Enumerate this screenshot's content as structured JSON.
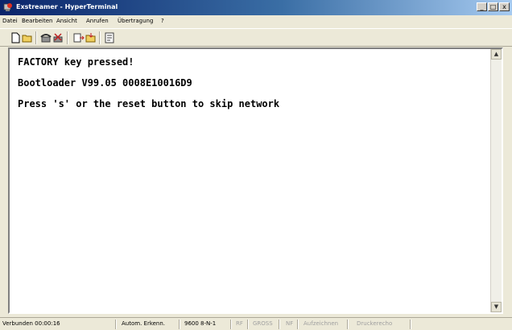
{
  "window": {
    "title": "Exstreamer - HyperTerminal",
    "controls": {
      "minimize": "_",
      "maximize": "□",
      "close": "x"
    }
  },
  "menu": [
    "Datei",
    "Bearbeiten",
    "Ansicht",
    "Anrufen",
    "Übertragung",
    "?"
  ],
  "toolbar": {
    "buttons": [
      "new-document-icon",
      "open-folder-icon",
      "phone-call-icon",
      "disconnect-icon",
      "send-icon",
      "receive-icon",
      "properties-icon"
    ]
  },
  "terminal": {
    "lines": [
      "FACTORY key pressed!",
      "Bootloader V99.05 0008E10016D9",
      "Press 's' or the reset button to skip network"
    ]
  },
  "status": {
    "connected": "Verbunden 00:00:16",
    "detect": "Autom. Erkenn.",
    "port": "9600 8-N-1",
    "rf": "RF",
    "caps": "GROSS",
    "nf": "NF",
    "record": "Aufzeichnen",
    "printecho": "Druckerecho"
  },
  "colors": {
    "title_start": "#0a246a",
    "title_end": "#a6caf0",
    "chrome": "#ece9d8",
    "terminal_bg": "#ffffff"
  }
}
